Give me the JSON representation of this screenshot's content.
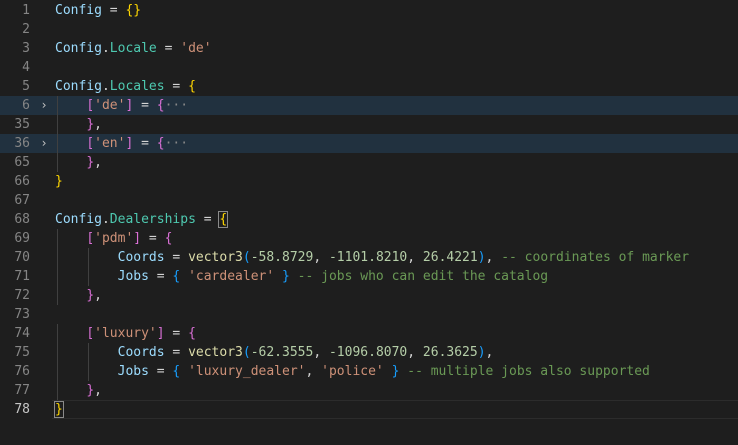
{
  "editor": {
    "lines": [
      {
        "n": "1",
        "tokens": [
          {
            "t": "Config",
            "c": "var"
          },
          {
            "t": " = ",
            "c": ""
          },
          {
            "t": "{}",
            "c": "p1"
          }
        ]
      },
      {
        "n": "2",
        "tokens": []
      },
      {
        "n": "3",
        "tokens": [
          {
            "t": "Config",
            "c": "var"
          },
          {
            "t": ".",
            "c": ""
          },
          {
            "t": "Locale",
            "c": "fld"
          },
          {
            "t": " = ",
            "c": ""
          },
          {
            "t": "'de'",
            "c": "str"
          }
        ]
      },
      {
        "n": "4",
        "tokens": []
      },
      {
        "n": "5",
        "tokens": [
          {
            "t": "Config",
            "c": "var"
          },
          {
            "t": ".",
            "c": ""
          },
          {
            "t": "Locales",
            "c": "fld"
          },
          {
            "t": " = ",
            "c": ""
          },
          {
            "t": "{",
            "c": "p1"
          }
        ]
      },
      {
        "n": "6",
        "folded": true,
        "highlight": true,
        "tokens": [
          {
            "t": "    ",
            "c": ""
          },
          {
            "t": "[",
            "c": "p2"
          },
          {
            "t": "'de'",
            "c": "str"
          },
          {
            "t": "]",
            "c": "p2"
          },
          {
            "t": " = ",
            "c": ""
          },
          {
            "t": "{",
            "c": "p2"
          },
          {
            "t": "···",
            "c": "ell"
          }
        ]
      },
      {
        "n": "35",
        "tokens": [
          {
            "t": "    ",
            "c": ""
          },
          {
            "t": "}",
            "c": "p2"
          },
          {
            "t": ",",
            "c": ""
          }
        ]
      },
      {
        "n": "36",
        "folded": true,
        "highlight": true,
        "tokens": [
          {
            "t": "    ",
            "c": ""
          },
          {
            "t": "[",
            "c": "p2"
          },
          {
            "t": "'en'",
            "c": "str"
          },
          {
            "t": "]",
            "c": "p2"
          },
          {
            "t": " = ",
            "c": ""
          },
          {
            "t": "{",
            "c": "p2"
          },
          {
            "t": "···",
            "c": "ell"
          }
        ]
      },
      {
        "n": "65",
        "tokens": [
          {
            "t": "    ",
            "c": ""
          },
          {
            "t": "}",
            "c": "p2"
          },
          {
            "t": ",",
            "c": ""
          }
        ]
      },
      {
        "n": "66",
        "tokens": [
          {
            "t": "}",
            "c": "p1"
          }
        ]
      },
      {
        "n": "67",
        "tokens": []
      },
      {
        "n": "68",
        "tokens": [
          {
            "t": "Config",
            "c": "var"
          },
          {
            "t": ".",
            "c": ""
          },
          {
            "t": "Dealerships",
            "c": "fld"
          },
          {
            "t": " = ",
            "c": ""
          },
          {
            "t": "{",
            "c": "p1 bm"
          }
        ]
      },
      {
        "n": "69",
        "tokens": [
          {
            "t": "    ",
            "c": ""
          },
          {
            "t": "[",
            "c": "p2"
          },
          {
            "t": "'pdm'",
            "c": "str"
          },
          {
            "t": "]",
            "c": "p2"
          },
          {
            "t": " = ",
            "c": ""
          },
          {
            "t": "{",
            "c": "p2"
          }
        ]
      },
      {
        "n": "70",
        "tokens": [
          {
            "t": "        ",
            "c": ""
          },
          {
            "t": "Coords",
            "c": "var"
          },
          {
            "t": " = ",
            "c": ""
          },
          {
            "t": "vector3",
            "c": "fn"
          },
          {
            "t": "(",
            "c": "p3"
          },
          {
            "t": "-58.8729",
            "c": "num"
          },
          {
            "t": ", ",
            "c": ""
          },
          {
            "t": "-1101.8210",
            "c": "num"
          },
          {
            "t": ", ",
            "c": ""
          },
          {
            "t": "26.4221",
            "c": "num"
          },
          {
            "t": ")",
            "c": "p3"
          },
          {
            "t": ", ",
            "c": ""
          },
          {
            "t": "-- coordinates of marker",
            "c": "cmt"
          }
        ]
      },
      {
        "n": "71",
        "tokens": [
          {
            "t": "        ",
            "c": ""
          },
          {
            "t": "Jobs",
            "c": "var"
          },
          {
            "t": " = ",
            "c": ""
          },
          {
            "t": "{",
            "c": "p3"
          },
          {
            "t": " ",
            "c": ""
          },
          {
            "t": "'cardealer'",
            "c": "str"
          },
          {
            "t": " ",
            "c": ""
          },
          {
            "t": "}",
            "c": "p3"
          },
          {
            "t": " ",
            "c": ""
          },
          {
            "t": "-- jobs who can edit the catalog",
            "c": "cmt"
          }
        ]
      },
      {
        "n": "72",
        "tokens": [
          {
            "t": "    ",
            "c": ""
          },
          {
            "t": "}",
            "c": "p2"
          },
          {
            "t": ",",
            "c": ""
          }
        ]
      },
      {
        "n": "73",
        "tokens": []
      },
      {
        "n": "74",
        "tokens": [
          {
            "t": "    ",
            "c": ""
          },
          {
            "t": "[",
            "c": "p2"
          },
          {
            "t": "'luxury'",
            "c": "str"
          },
          {
            "t": "]",
            "c": "p2"
          },
          {
            "t": " = ",
            "c": ""
          },
          {
            "t": "{",
            "c": "p2"
          }
        ]
      },
      {
        "n": "75",
        "tokens": [
          {
            "t": "        ",
            "c": ""
          },
          {
            "t": "Coords",
            "c": "var"
          },
          {
            "t": " = ",
            "c": ""
          },
          {
            "t": "vector3",
            "c": "fn"
          },
          {
            "t": "(",
            "c": "p3"
          },
          {
            "t": "-62.3555",
            "c": "num"
          },
          {
            "t": ", ",
            "c": ""
          },
          {
            "t": "-1096.8070",
            "c": "num"
          },
          {
            "t": ", ",
            "c": ""
          },
          {
            "t": "26.3625",
            "c": "num"
          },
          {
            "t": ")",
            "c": "p3"
          },
          {
            "t": ",",
            "c": ""
          }
        ]
      },
      {
        "n": "76",
        "tokens": [
          {
            "t": "        ",
            "c": ""
          },
          {
            "t": "Jobs",
            "c": "var"
          },
          {
            "t": " = ",
            "c": ""
          },
          {
            "t": "{",
            "c": "p3"
          },
          {
            "t": " ",
            "c": ""
          },
          {
            "t": "'luxury_dealer'",
            "c": "str"
          },
          {
            "t": ", ",
            "c": ""
          },
          {
            "t": "'police'",
            "c": "str"
          },
          {
            "t": " ",
            "c": ""
          },
          {
            "t": "}",
            "c": "p3"
          },
          {
            "t": " ",
            "c": ""
          },
          {
            "t": "-- multiple jobs also supported",
            "c": "cmt"
          }
        ]
      },
      {
        "n": "77",
        "tokens": [
          {
            "t": "    ",
            "c": ""
          },
          {
            "t": "}",
            "c": "p2"
          },
          {
            "t": ",",
            "c": ""
          }
        ]
      },
      {
        "n": "78",
        "current": true,
        "tokens": [
          {
            "t": "}",
            "c": "p1 bm"
          }
        ]
      }
    ],
    "fold_icon": "chevron-right-icon",
    "fold_glyph": "›"
  }
}
